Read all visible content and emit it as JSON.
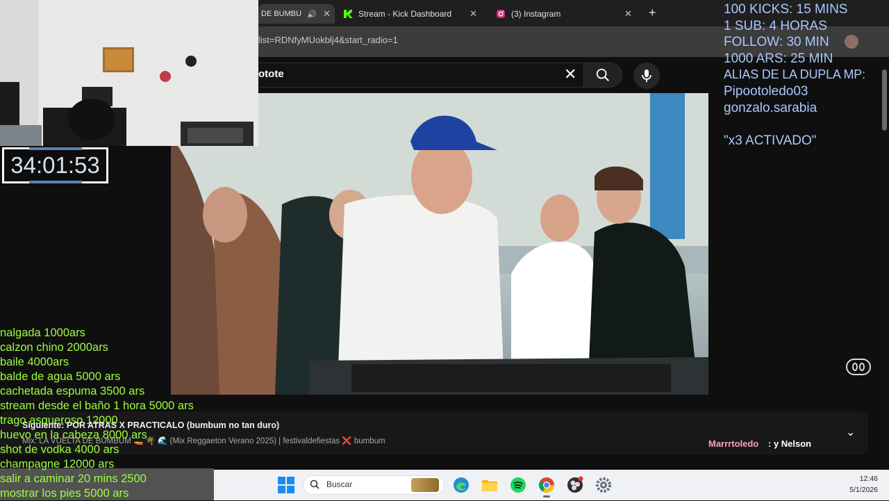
{
  "browser": {
    "tabs": [
      {
        "title": "DE BUMBU",
        "close": "✕"
      },
      {
        "title": "Stream - Kick Dashboard",
        "close": "✕"
      },
      {
        "title": "(3) Instagram",
        "close": "✕"
      }
    ],
    "new_tab": "+",
    "url": "list=RDNfyMUokblj4&start_radio=1"
  },
  "youtube": {
    "search_value": "otote",
    "clear": "✕",
    "up_next_title": "Siguiente: POR ATRAS X PRACTICALO (bumbum no tan duro)",
    "up_next_subtitle": "Mix: LA VUELTA DE BUMBUM 🚤 🌴 🌊 (Mix Reggaeton Verano 2025) | festivaldefiestas ❌ bumbum",
    "chevron": "⌄"
  },
  "timer": "34:01:53",
  "goals": [
    "100 KICKS: 15 MINS",
    "1 SUB: 4 HORAS",
    "FOLLOW: 30 MIN",
    "1000 ARS: 25 MIN",
    "ALIAS DE LA DUPLA MP:",
    "Pipootoledo03",
    "gonzalo.sarabia",
    "",
    "\"x3 ACTIVADO\""
  ],
  "price_list": [
    "nalgada 1000ars",
    "calzon chino 2000ars",
    "baile 4000ars",
    "balde de agua 5000 ars",
    "cachetada espuma 3500 ars",
    "stream desde el baño 1 hora 5000 ars",
    "trago asqueroso 12000",
    "huevo en la cabeza 8000 ars",
    "shot de vodka 4000 ars",
    "champagne 12000 ars",
    "salir a caminar 20 mins 2500",
    "mostrar los pies 5000 ars"
  ],
  "chat": {
    "user": "Marrrtoledo",
    "message": ": y Nelson"
  },
  "taskbar": {
    "search_placeholder": "Buscar",
    "time": "12:46",
    "date": "5/1/2026"
  },
  "colors": {
    "kick": "#53fc18",
    "youtube_bg": "#0f0f0f",
    "overlay_blue": "#a8c8ff",
    "overlay_green": "#9cff3c"
  }
}
